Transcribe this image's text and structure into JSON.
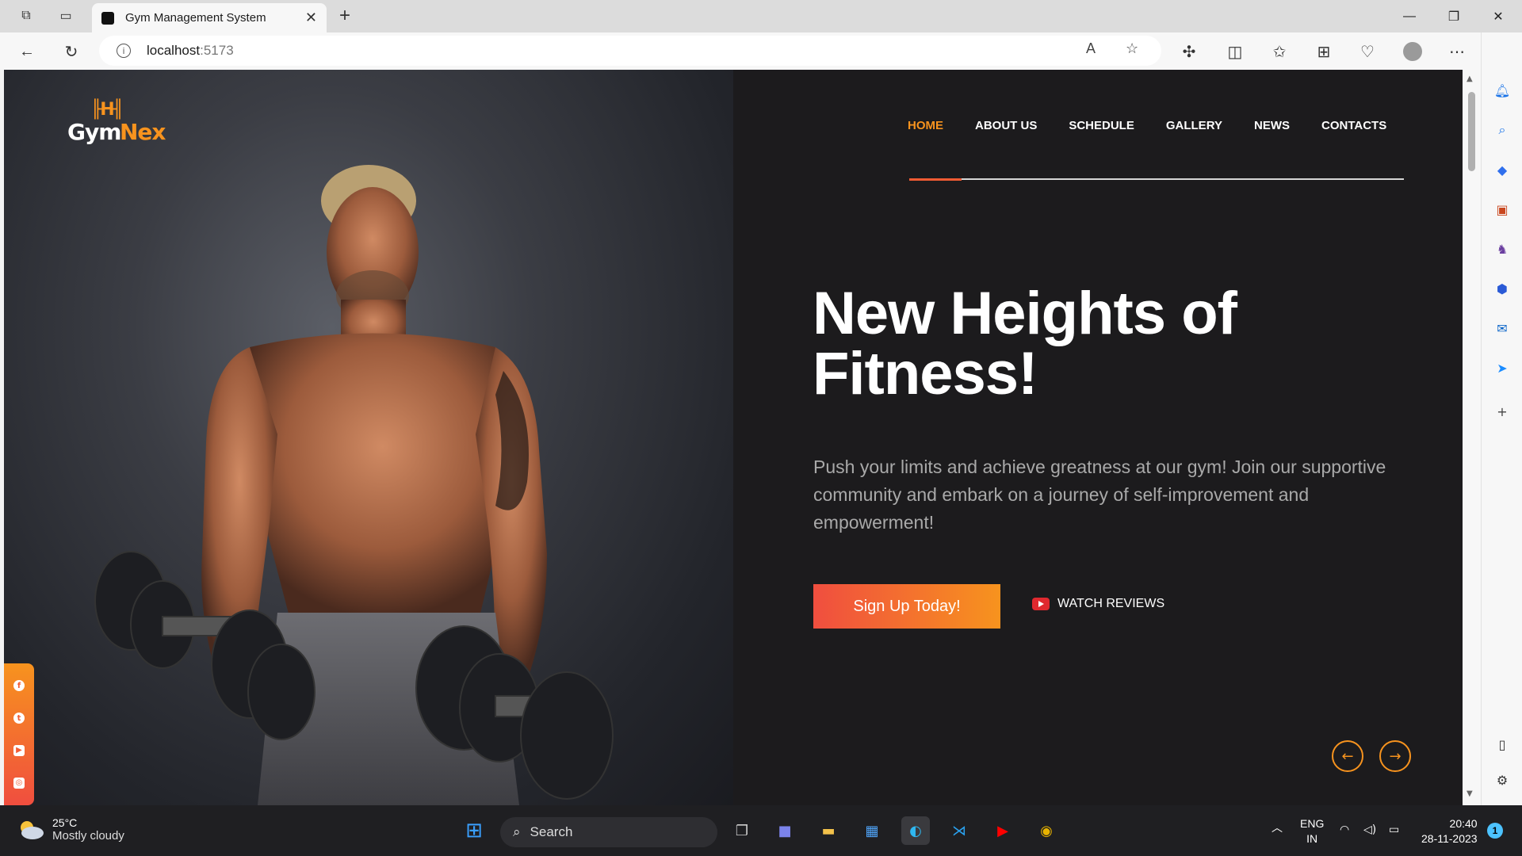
{
  "browser": {
    "tab_title": "Gym Management System",
    "address_host": "localhost",
    "address_port": ":5173"
  },
  "site": {
    "logo_part1": "Gym",
    "logo_part2": "Nex",
    "nav": [
      {
        "label": "HOME",
        "active": true
      },
      {
        "label": "ABOUT US",
        "active": false
      },
      {
        "label": "SCHEDULE",
        "active": false
      },
      {
        "label": "GALLERY",
        "active": false
      },
      {
        "label": "NEWS",
        "active": false
      },
      {
        "label": "CONTACTS",
        "active": false
      }
    ],
    "headline_line1": "New Heights of",
    "headline_line2": "Fitness!",
    "subtext": "Push your limits and achieve greatness at our gym! Join our supportive community and embark on a journey of self-improvement and empowerment!",
    "cta_label": "Sign Up Today!",
    "watch_label": "WATCH REVIEWS",
    "social": [
      "facebook-icon",
      "twitter-icon",
      "youtube-icon",
      "instagram-icon"
    ],
    "accent_color": "#f7931e",
    "accent_color_2": "#f04e3f"
  },
  "taskbar": {
    "weather_temp": "25°C",
    "weather_desc": "Mostly cloudy",
    "search_label": "Search",
    "lang_line1": "ENG",
    "lang_line2": "IN",
    "time": "20:40",
    "date": "28-11-2023",
    "notification_count": "1"
  }
}
